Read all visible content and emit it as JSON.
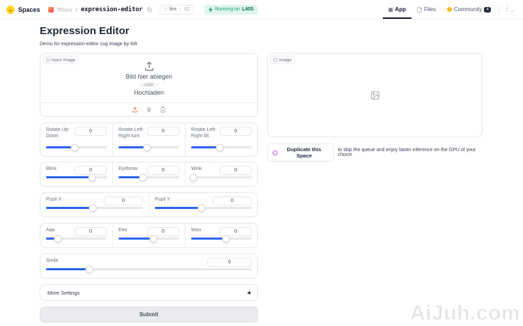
{
  "header": {
    "brand": "Spaces",
    "owner": "fffiloni",
    "separator": "/",
    "space_name": "expression-editor",
    "like_label": "like",
    "like_count": "62",
    "running_label": "Running on",
    "running_hardware": "L40S",
    "nav": {
      "app": "App",
      "files": "Files",
      "community": "Community",
      "community_count": "4"
    }
  },
  "icons": {
    "heart": "♡",
    "app_grid": "▦",
    "menu_dots": "⋮",
    "external": "↗",
    "accordion_collapsed": "◀"
  },
  "page": {
    "title": "Expression Editor",
    "subtitle": "Demo for expression-editor cog image by fofr"
  },
  "input_image": {
    "label": "Input Image",
    "drop_text": "Bild hier ablegen",
    "or_text": "- oder -",
    "upload_text": "Hochladen"
  },
  "output_image": {
    "label": "Image"
  },
  "duplicate": {
    "button": "Duplicate this Space",
    "text": "to skip the queue and enjoy faster inference on the GPU of your choice"
  },
  "sliders": {
    "rows": [
      {
        "items": [
          {
            "label": "Rotate Up-Down",
            "value": "0",
            "pos": 47
          },
          {
            "label": "Rotate Left-Right turn",
            "value": "0",
            "pos": 47
          },
          {
            "label": "Rotate Left-Right tilt",
            "value": "0",
            "pos": 47
          }
        ]
      },
      {
        "items": [
          {
            "label": "Blink",
            "value": "0",
            "pos": 76
          },
          {
            "label": "Eyebrow",
            "value": "0",
            "pos": 40
          },
          {
            "label": "Wink",
            "value": "0",
            "pos": 4
          }
        ]
      },
      {
        "items": [
          {
            "label": "Pupil X",
            "value": "0",
            "pos": 48
          },
          {
            "label": "Pupil Y",
            "value": "0",
            "pos": 48
          }
        ]
      },
      {
        "items": [
          {
            "label": "Aaa",
            "value": "0",
            "pos": 20
          },
          {
            "label": "Eee",
            "value": "0",
            "pos": 58
          },
          {
            "label": "Woo",
            "value": "0",
            "pos": 57
          }
        ]
      },
      {
        "items": [
          {
            "label": "Smile",
            "value": "0",
            "pos": 21
          }
        ]
      }
    ]
  },
  "more_settings": {
    "label": "More Settings"
  },
  "submit": {
    "label": "Submit"
  },
  "watermark": "AiJuh.com",
  "colors": {
    "accent_blue": "#2563eb",
    "running_green": "#0e9f6e",
    "community_yellow": "#fbbf24",
    "duplicate_purple": "#a855f7",
    "upload_orange": "#ea580c"
  }
}
